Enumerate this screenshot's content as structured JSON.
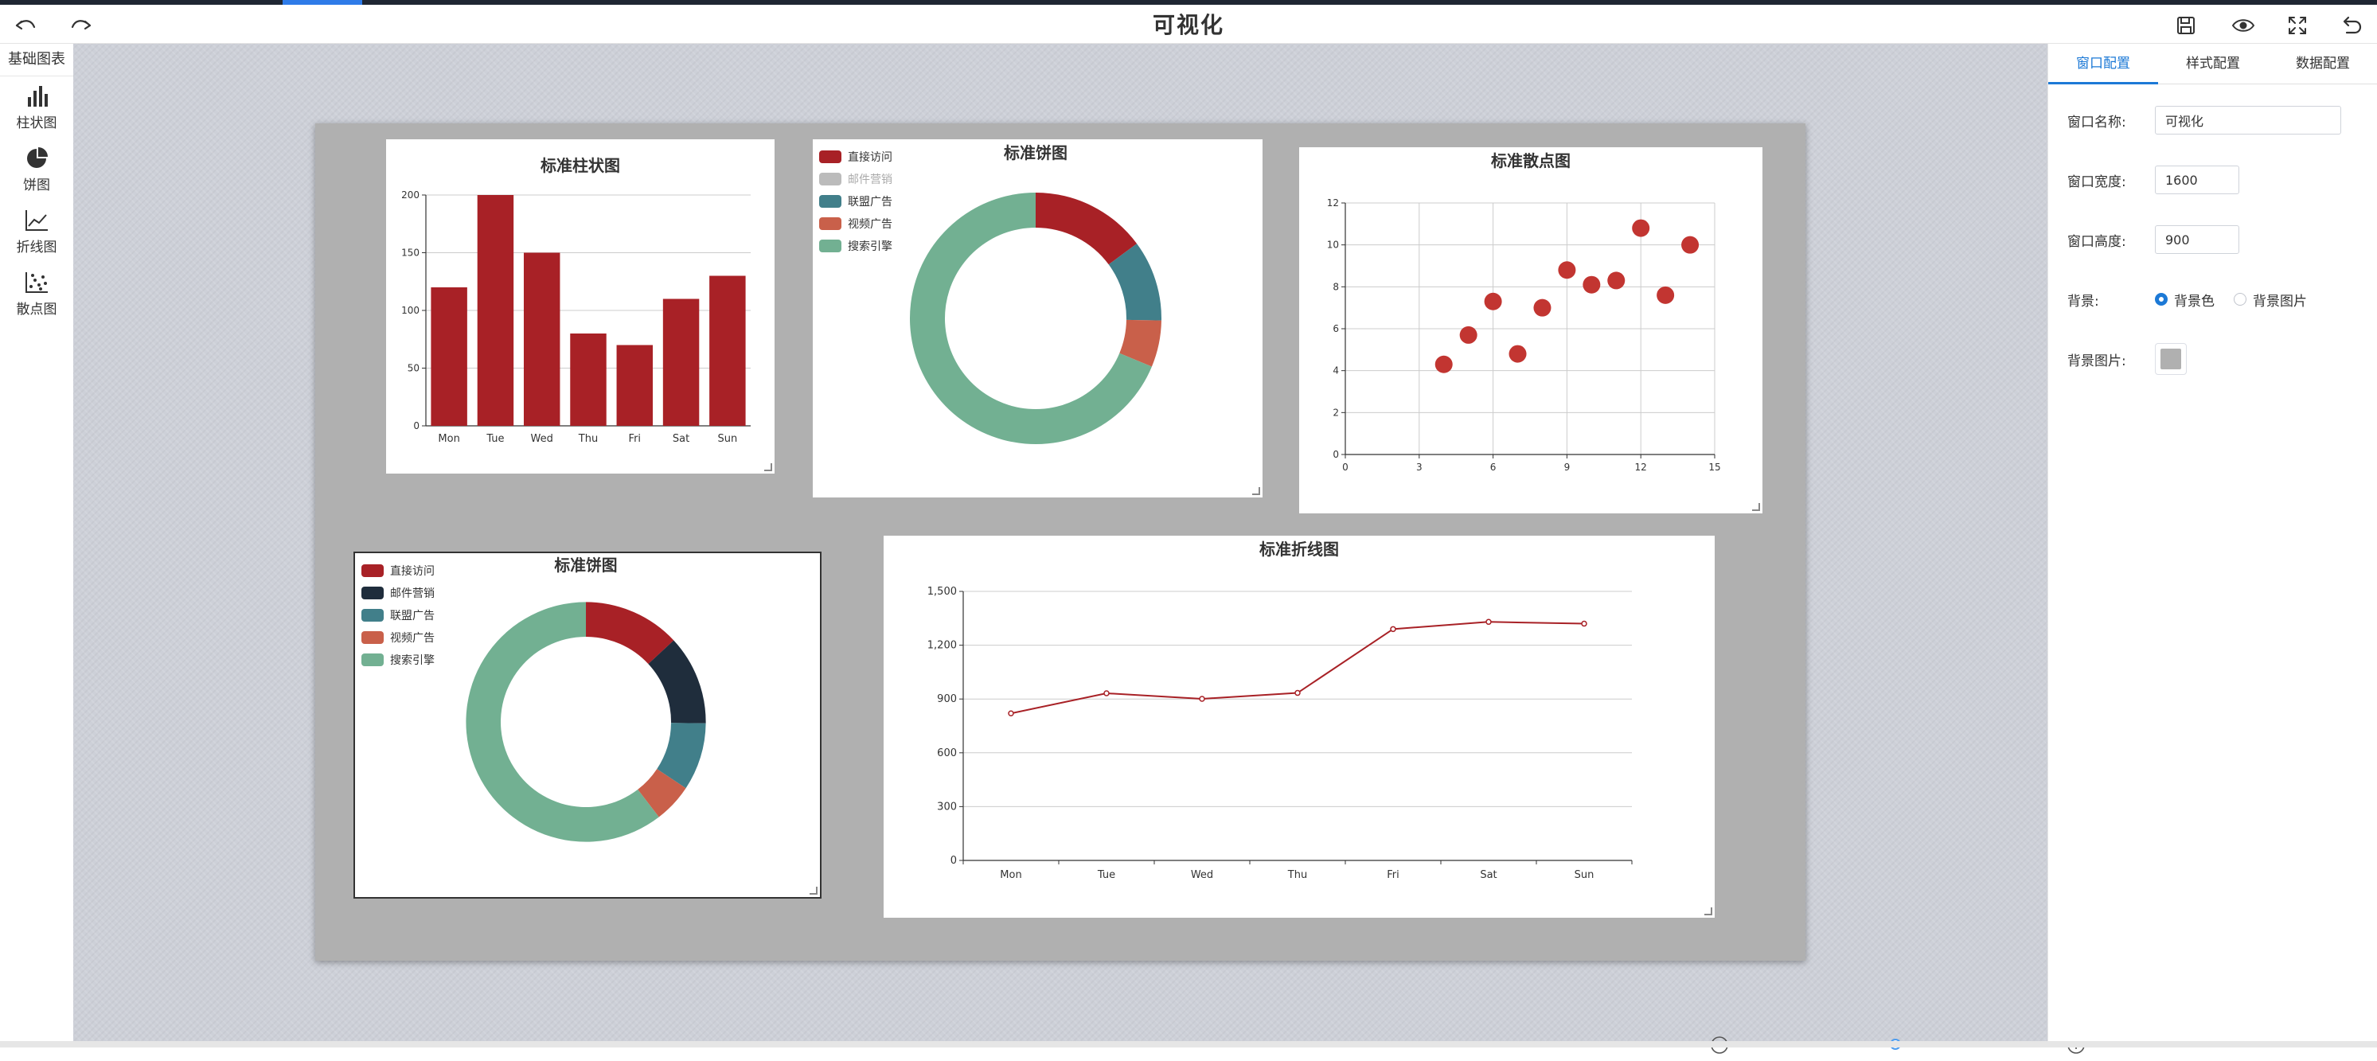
{
  "app": {
    "title": "可视化"
  },
  "left": {
    "header": "基础图表",
    "tools": [
      {
        "label": "柱状图",
        "icon": "bar-chart-icon"
      },
      {
        "label": "饼图",
        "icon": "pie-chart-icon"
      },
      {
        "label": "折线图",
        "icon": "line-chart-icon"
      },
      {
        "label": "散点图",
        "icon": "scatter-chart-icon"
      }
    ]
  },
  "right": {
    "tabs": [
      "窗口配置",
      "样式配置",
      "数据配置"
    ],
    "active_tab": 0,
    "form": {
      "name_label": "窗口名称:",
      "name_value": "可视化",
      "width_label": "窗口宽度:",
      "width_value": "1600",
      "height_label": "窗口高度:",
      "height_value": "900",
      "bg_label": "背景:",
      "bg_options": [
        "背景色",
        "背景图片"
      ],
      "bg_selected": 0,
      "bgimg_label": "背景图片:",
      "bg_color": "#b0b0b0"
    }
  },
  "zoom": {
    "value": 0.5
  },
  "colors": {
    "red": "#a82126",
    "navy": "#1f2d3c",
    "teal": "#417f8a",
    "orange": "#c9604a",
    "green": "#72b092",
    "scatter": "#c23531",
    "accent": "#1c79d6"
  },
  "chart_data": [
    {
      "id": "bar",
      "type": "bar",
      "title": "标准柱状图",
      "categories": [
        "Mon",
        "Tue",
        "Wed",
        "Thu",
        "Fri",
        "Sat",
        "Sun"
      ],
      "values": [
        120,
        200,
        150,
        80,
        70,
        110,
        130
      ],
      "ylim": [
        0,
        200
      ],
      "yticks": [
        0,
        50,
        100,
        150,
        200
      ],
      "grid": true
    },
    {
      "id": "pie1",
      "type": "pie",
      "title": "标准饼图",
      "legend_position": "top-left",
      "slices": [
        {
          "name": "直接访问",
          "value": 335,
          "color": "#a82126",
          "visible": true
        },
        {
          "name": "邮件营销",
          "value": 310,
          "color": "#1f2d3c",
          "visible": false
        },
        {
          "name": "联盟广告",
          "value": 234,
          "color": "#417f8a",
          "visible": true
        },
        {
          "name": "视频广告",
          "value": 135,
          "color": "#c9604a",
          "visible": true
        },
        {
          "name": "搜索引擎",
          "value": 1548,
          "color": "#72b092",
          "visible": true
        }
      ]
    },
    {
      "id": "scatter",
      "type": "scatter",
      "title": "标准散点图",
      "points": [
        [
          4,
          4.3
        ],
        [
          5,
          5.7
        ],
        [
          6,
          7.3
        ],
        [
          7,
          4.8
        ],
        [
          8,
          7.0
        ],
        [
          9,
          8.8
        ],
        [
          10,
          8.1
        ],
        [
          11,
          8.3
        ],
        [
          12,
          10.8
        ],
        [
          13,
          7.6
        ],
        [
          14,
          10.0
        ]
      ],
      "xlim": [
        0,
        15
      ],
      "xticks": [
        0,
        3,
        6,
        9,
        12,
        15
      ],
      "ylim": [
        0,
        12
      ],
      "yticks": [
        0,
        2,
        4,
        6,
        8,
        10,
        12
      ],
      "grid": true
    },
    {
      "id": "pie2",
      "type": "pie",
      "title": "标准饼图",
      "legend_position": "top-left",
      "slices": [
        {
          "name": "直接访问",
          "value": 335,
          "color": "#a82126",
          "visible": true
        },
        {
          "name": "邮件营销",
          "value": 310,
          "color": "#1f2d3c",
          "visible": true
        },
        {
          "name": "联盟广告",
          "value": 234,
          "color": "#417f8a",
          "visible": true
        },
        {
          "name": "视频广告",
          "value": 135,
          "color": "#c9604a",
          "visible": true
        },
        {
          "name": "搜索引擎",
          "value": 1548,
          "color": "#72b092",
          "visible": true
        }
      ]
    },
    {
      "id": "line",
      "type": "line",
      "title": "标准折线图",
      "categories": [
        "Mon",
        "Tue",
        "Wed",
        "Thu",
        "Fri",
        "Sat",
        "Sun"
      ],
      "values": [
        820,
        932,
        901,
        934,
        1290,
        1330,
        1320
      ],
      "ylim": [
        0,
        1500
      ],
      "yticks": [
        0,
        300,
        600,
        900,
        1200,
        1500
      ],
      "ytick_labels": [
        "0",
        "300",
        "600",
        "900",
        "1,200",
        "1,500"
      ],
      "grid": true
    }
  ]
}
